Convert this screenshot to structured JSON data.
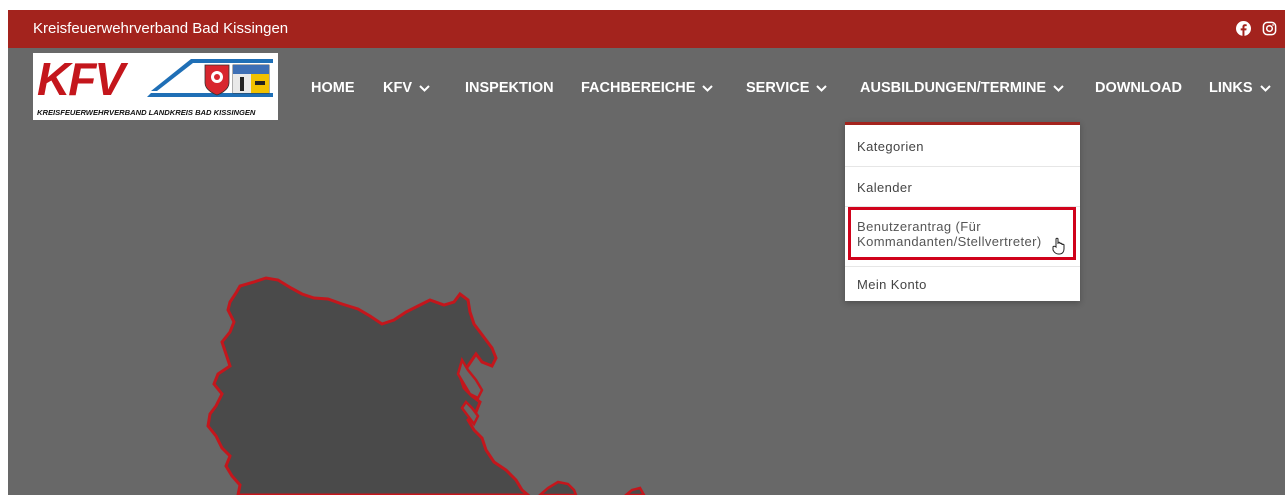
{
  "topbar": {
    "site_name": "Kreisfeuerwehrverband Bad Kissingen",
    "social_icons": [
      "facebook-icon",
      "instagram-icon"
    ]
  },
  "logo": {
    "letters": "KFV",
    "tagline": "KREISFEUERWEHRVERBAND LANDKREIS BAD KISSINGEN"
  },
  "nav": {
    "items": [
      {
        "label": "HOME",
        "has_dropdown": false
      },
      {
        "label": "KFV",
        "has_dropdown": true
      },
      {
        "label": "INSPEKTION",
        "has_dropdown": false
      },
      {
        "label": "FACHBEREICHE",
        "has_dropdown": true
      },
      {
        "label": "SERVICE",
        "has_dropdown": true
      },
      {
        "label": "AUSBILDUNGEN/TERMINE",
        "has_dropdown": true
      },
      {
        "label": "DOWNLOAD",
        "has_dropdown": false
      },
      {
        "label": "LINKS",
        "has_dropdown": true
      }
    ]
  },
  "dropdown": {
    "items": [
      {
        "label": "Kategorien"
      },
      {
        "label": "Kalender"
      },
      {
        "label": "Benutzerantrag (Für",
        "label_line2": "Kommandanten/Stellvertreter)",
        "highlighted": true
      },
      {
        "label": "Mein Konto"
      }
    ]
  },
  "colors": {
    "brand_red": "#a3231d",
    "background_gray": "#686868",
    "map_fill": "#4a4a4a",
    "map_outline": "#c4161c",
    "highlight_red": "#d0021b"
  }
}
